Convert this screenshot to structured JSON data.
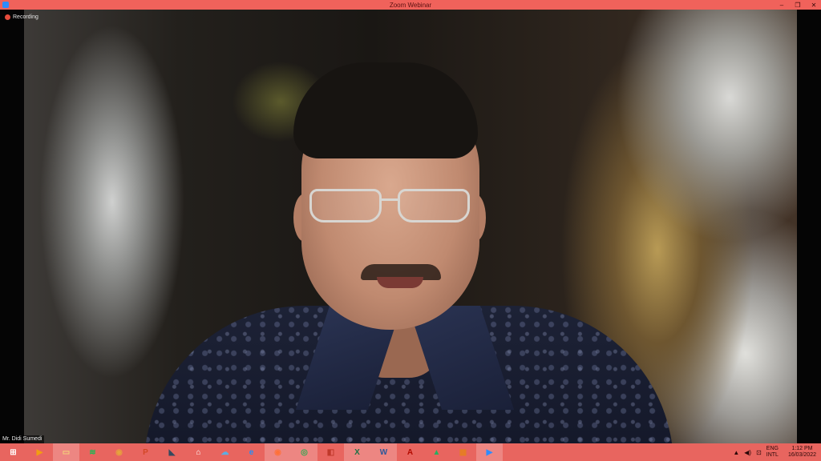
{
  "window": {
    "title": "Zoom Webinar"
  },
  "meeting": {
    "recording_label": "Recording",
    "participant_name": "Mr. Didi Sumedi"
  },
  "taskbar": {
    "apps": [
      {
        "name": "start-button",
        "glyph": "⊞",
        "color": "#ffffff"
      },
      {
        "name": "media-player-icon",
        "glyph": "▶",
        "color": "#f39c12"
      },
      {
        "name": "file-explorer-icon",
        "glyph": "▭",
        "color": "#f4d27a",
        "active": true
      },
      {
        "name": "spotify-icon",
        "glyph": "≋",
        "color": "#1db954"
      },
      {
        "name": "database-icon",
        "glyph": "◉",
        "color": "#e6a23c"
      },
      {
        "name": "powerpoint-icon",
        "glyph": "P",
        "color": "#d24726"
      },
      {
        "name": "scanner-icon",
        "glyph": "◣",
        "color": "#34495e"
      },
      {
        "name": "home-icon",
        "glyph": "⌂",
        "color": "#ffffff"
      },
      {
        "name": "cloud-icon",
        "glyph": "☁",
        "color": "#5dade2"
      },
      {
        "name": "internet-explorer-icon",
        "glyph": "e",
        "color": "#1e90ff"
      },
      {
        "name": "firefox-icon",
        "glyph": "◉",
        "color": "#ff7139",
        "active": true
      },
      {
        "name": "chrome-icon",
        "glyph": "◎",
        "color": "#34a853",
        "active": true
      },
      {
        "name": "pdf-viewer-icon",
        "glyph": "◧",
        "color": "#c0392b"
      },
      {
        "name": "excel-icon",
        "glyph": "X",
        "color": "#1e7145",
        "active": true
      },
      {
        "name": "word-icon",
        "glyph": "W",
        "color": "#2b579a",
        "active": true
      },
      {
        "name": "acrobat-icon",
        "glyph": "A",
        "color": "#b30b00"
      },
      {
        "name": "arrow-app-icon",
        "glyph": "▲",
        "color": "#27ae60"
      },
      {
        "name": "office-icon",
        "glyph": "▦",
        "color": "#e67e22"
      },
      {
        "name": "zoom-icon",
        "glyph": "▶",
        "color": "#2d8cff",
        "active": true
      }
    ]
  },
  "tray": {
    "language_line1": "ENG",
    "language_line2": "INTL",
    "time": "1:12 PM",
    "date": "16/03/2022"
  }
}
